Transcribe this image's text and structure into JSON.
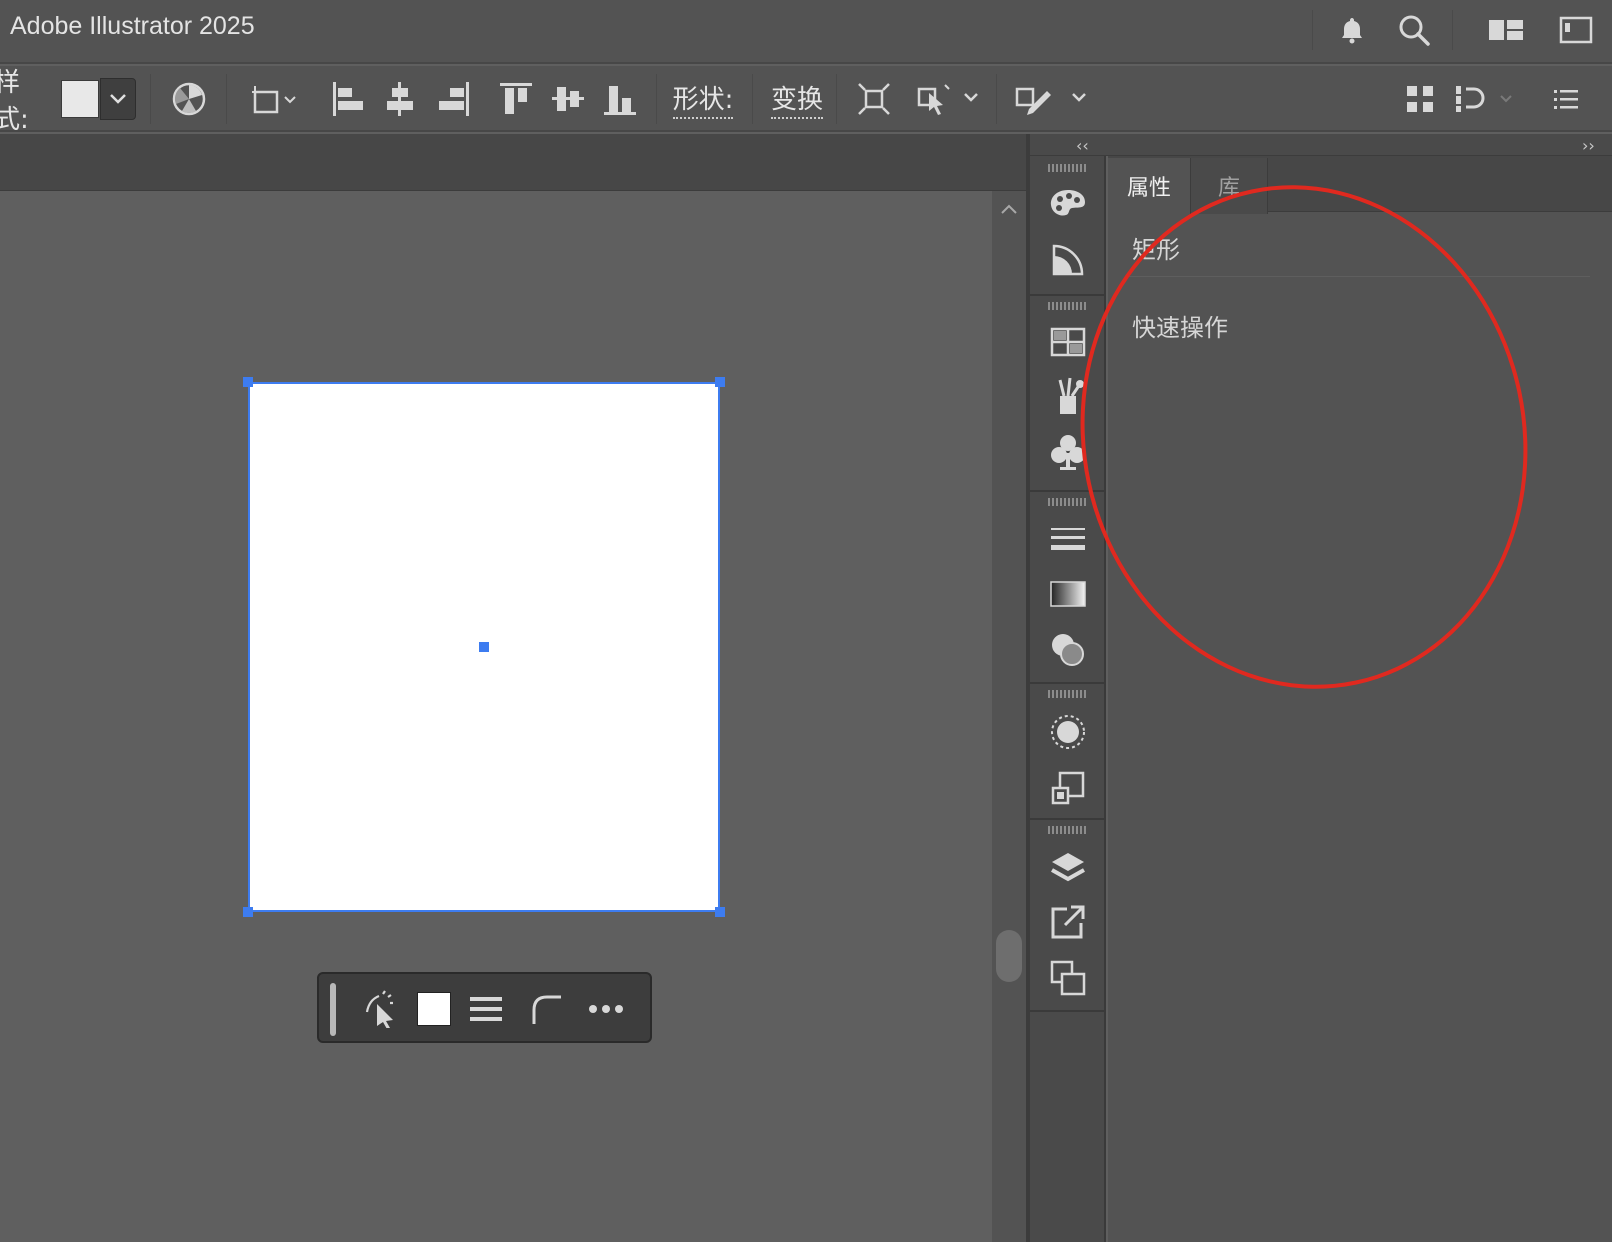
{
  "app": {
    "title": "Adobe Illustrator 2025"
  },
  "titlebar": {
    "icons": [
      "bell-icon",
      "search-icon",
      "workspace-layout-icon",
      "panel-toggle-icon"
    ]
  },
  "controlbar": {
    "style_label": "样式:",
    "shape_label": "形状:",
    "transform_label": "变换"
  },
  "panel": {
    "tabs": [
      {
        "label": "属性",
        "active": true
      },
      {
        "label": "库",
        "active": false
      }
    ],
    "collapse_left": "‹‹",
    "collapse_right": "››",
    "sections": {
      "object_type": "矩形",
      "quick_actions": "快速操作"
    }
  },
  "colors": {
    "selection": "#3d7cf0",
    "annotation": "#e0291f",
    "artboard_fill": "#ffffff"
  }
}
